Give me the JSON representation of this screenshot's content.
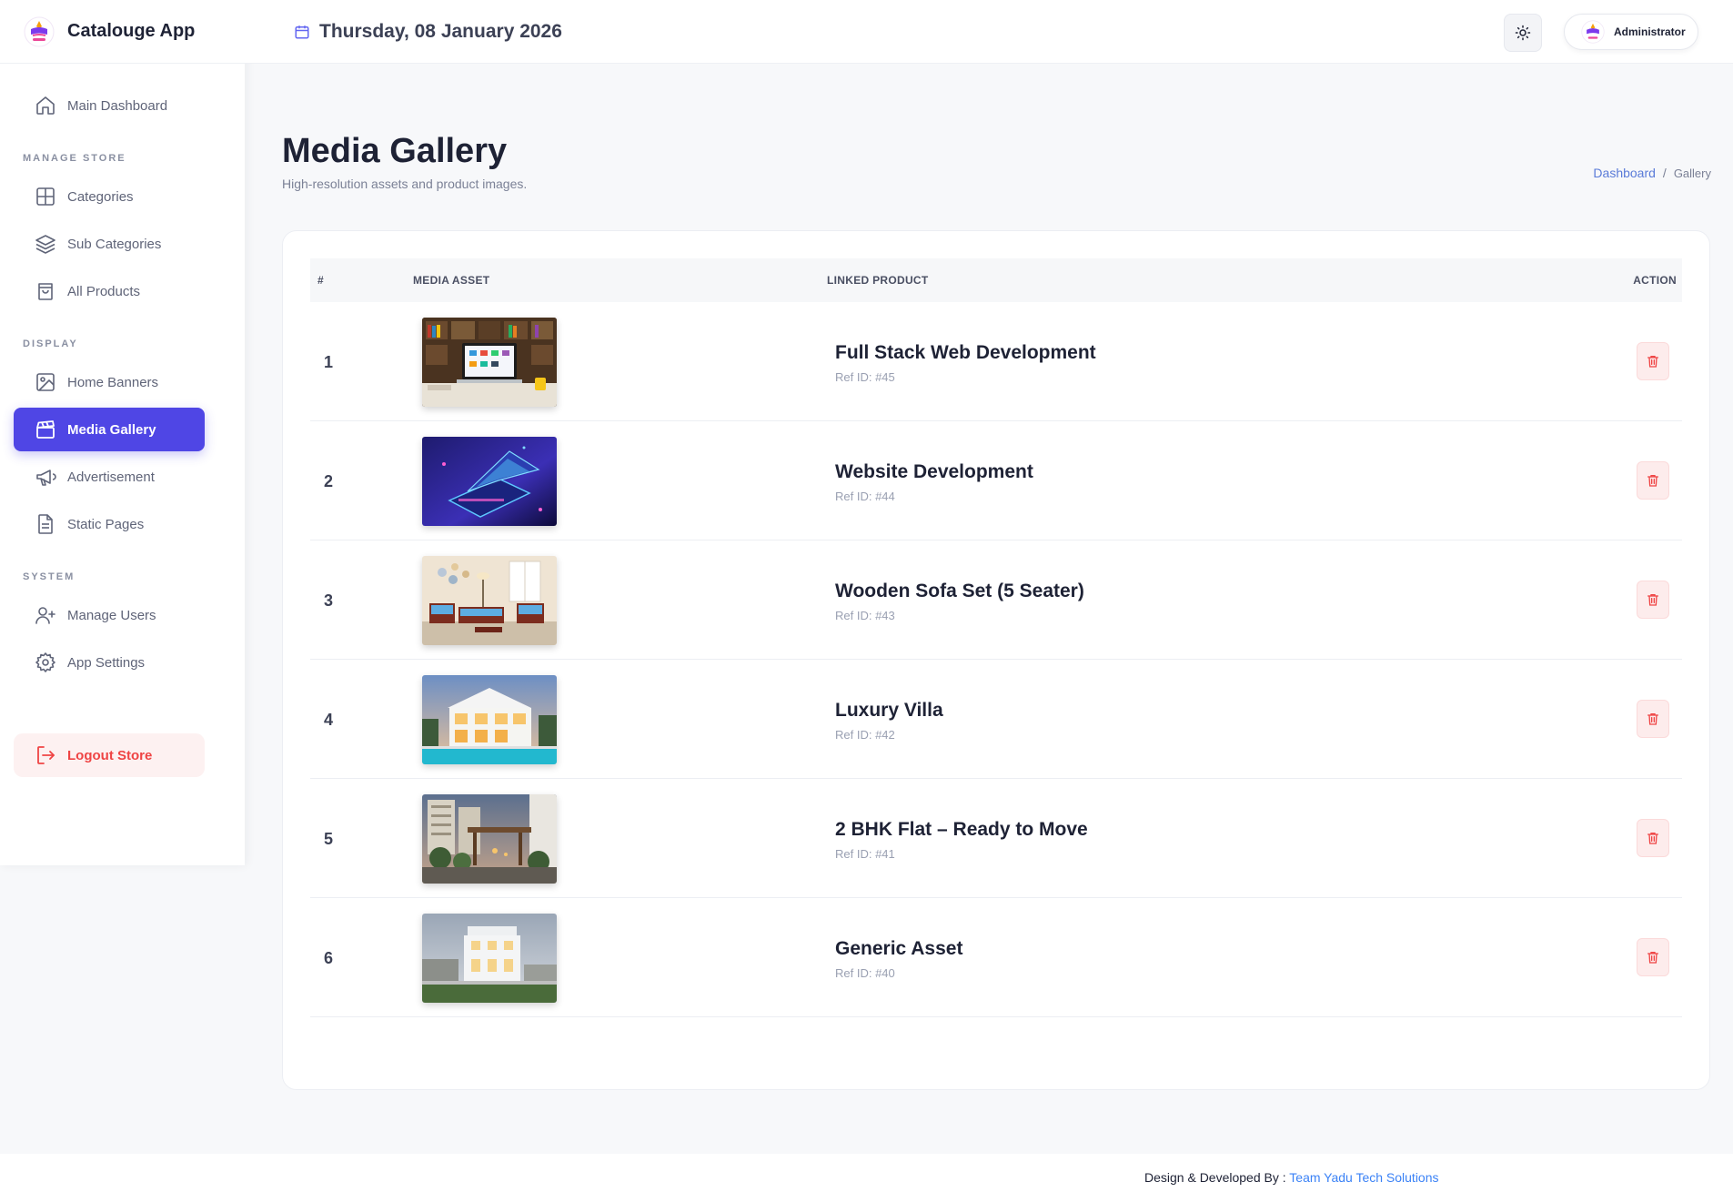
{
  "app": {
    "name": "Catalouge App"
  },
  "header": {
    "date": "Thursday, 08 January 2026",
    "user": "Administrator"
  },
  "sidebar": {
    "main": {
      "label": "Main Dashboard",
      "icon": "home-icon"
    },
    "sections": [
      {
        "title": "MANAGE STORE",
        "items": [
          {
            "label": "Categories",
            "icon": "grid-icon"
          },
          {
            "label": "Sub Categories",
            "icon": "layers-icon"
          },
          {
            "label": "All Products",
            "icon": "bag-icon"
          }
        ]
      },
      {
        "title": "DISPLAY",
        "items": [
          {
            "label": "Home Banners",
            "icon": "image-icon"
          },
          {
            "label": "Media Gallery",
            "icon": "clapper-icon",
            "active": true
          },
          {
            "label": "Advertisement",
            "icon": "megaphone-icon"
          },
          {
            "label": "Static Pages",
            "icon": "document-icon"
          }
        ]
      },
      {
        "title": "SYSTEM",
        "items": [
          {
            "label": "Manage Users",
            "icon": "user-plus-icon"
          },
          {
            "label": "App Settings",
            "icon": "gear-icon"
          }
        ]
      }
    ],
    "logout": "Logout Store"
  },
  "page": {
    "title": "Media Gallery",
    "subtitle": "High-resolution assets and product images.",
    "breadcrumb": {
      "link": "Dashboard",
      "separator": "/",
      "current": "Gallery"
    }
  },
  "table": {
    "headers": {
      "num": "#",
      "media": "MEDIA ASSET",
      "product": "LINKED PRODUCT",
      "action": "ACTION"
    },
    "rows": [
      {
        "num": "1",
        "product": "Full Stack Web Development",
        "ref": "Ref ID: #45"
      },
      {
        "num": "2",
        "product": "Website Development",
        "ref": "Ref ID: #44"
      },
      {
        "num": "3",
        "product": "Wooden Sofa Set (5 Seater)",
        "ref": "Ref ID: #43"
      },
      {
        "num": "4",
        "product": "Luxury Villa",
        "ref": "Ref ID: #42"
      },
      {
        "num": "5",
        "product": "2 BHK Flat – Ready to Move",
        "ref": "Ref ID: #41"
      },
      {
        "num": "6",
        "product": "Generic Asset",
        "ref": "Ref ID: #40"
      }
    ]
  },
  "footer": {
    "prefix": "Design & Developed By : ",
    "team": "Team Yadu Tech Solutions"
  },
  "colors": {
    "accent": "#4f46e5",
    "danger": "#ef4444",
    "link": "#3b82f6"
  }
}
